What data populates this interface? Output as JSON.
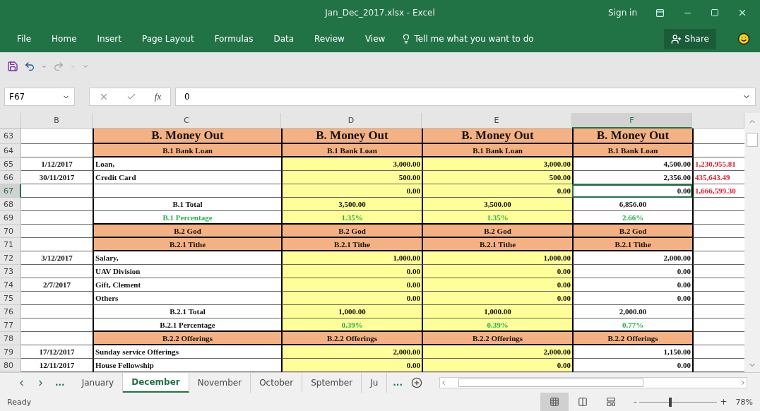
{
  "window": {
    "title": "Jan_Dec_2017.xlsx  -  Excel",
    "sign_in": "Sign in"
  },
  "menu": [
    {
      "label": "File"
    },
    {
      "label": "Home"
    },
    {
      "label": "Insert"
    },
    {
      "label": "Page Layout"
    },
    {
      "label": "Formulas"
    },
    {
      "label": "Data"
    },
    {
      "label": "Review"
    },
    {
      "label": "View"
    }
  ],
  "tell_me": "Tell me what you want to do",
  "share": "Share",
  "formula_bar": {
    "name_box": "F67",
    "fx": "fx",
    "value": "0"
  },
  "columns": [
    {
      "label": "B",
      "selected": false,
      "shaded": false
    },
    {
      "label": "C",
      "selected": false,
      "shaded": false
    },
    {
      "label": "D",
      "selected": false,
      "shaded": true
    },
    {
      "label": "E",
      "selected": false,
      "shaded": true
    },
    {
      "label": "F",
      "selected": true,
      "shaded": false
    }
  ],
  "rows": [
    {
      "n": "63",
      "kind": "title",
      "selected": false,
      "c": "B. Money Out",
      "d": "B. Money Out",
      "e": "B. Money Out",
      "f": "B. Money Out"
    },
    {
      "n": "64",
      "kind": "header",
      "selected": false,
      "c": "B.1 Bank Loan",
      "d": "B.1 Bank Loan",
      "e": "B.1 Bank Loan",
      "f": "B.1 Bank Loan"
    },
    {
      "n": "65",
      "kind": "item",
      "selected": false,
      "b": "1/12/2017",
      "c": "Loan,",
      "d": "3,000.00",
      "e": "3,000.00",
      "f": "4,500.00",
      "g": "1,230,955.81"
    },
    {
      "n": "66",
      "kind": "item",
      "selected": false,
      "b": "30/11/2017",
      "c": "Credit Card",
      "d": "500.00",
      "e": "500.00",
      "f": "2,356.00",
      "g": "435,643.49"
    },
    {
      "n": "67",
      "kind": "item",
      "selected": true,
      "d": "0.00",
      "e": "0.00",
      "f": "0.00",
      "g": "1,666,599.30"
    },
    {
      "n": "68",
      "kind": "total",
      "selected": false,
      "c": "B.1 Total",
      "d": "3,500.00",
      "e": "3,500.00",
      "f": "6,856.00"
    },
    {
      "n": "69",
      "kind": "percent",
      "selected": false,
      "label_green": true,
      "c": "B.1 Percentage",
      "d": "1.35%",
      "e": "1.35%",
      "f": "2.66%"
    },
    {
      "n": "70",
      "kind": "header",
      "selected": false,
      "c": "B.2 God",
      "d": "B.2 God",
      "e": "B.2 God",
      "f": "B.2 God"
    },
    {
      "n": "71",
      "kind": "header",
      "selected": false,
      "c": "B.2.1 Tithe",
      "d": "B.2.1 Tithe",
      "e": "B.2.1 Tithe",
      "f": "B.2.1 Tithe"
    },
    {
      "n": "72",
      "kind": "item",
      "selected": false,
      "b": "3/12/2017",
      "c": "Salary,",
      "d": "1,000.00",
      "e": "1,000.00",
      "f": "2,000.00"
    },
    {
      "n": "73",
      "kind": "item",
      "selected": false,
      "c": "UAV Division",
      "d": "0.00",
      "e": "0.00",
      "f": "0.00"
    },
    {
      "n": "74",
      "kind": "item",
      "selected": false,
      "b": "2/7/2017",
      "c": "Gift, Clement",
      "d": "0.00",
      "e": "0.00",
      "f": "0.00"
    },
    {
      "n": "75",
      "kind": "item",
      "selected": false,
      "c": "Others",
      "d": "0.00",
      "e": "0.00",
      "f": "0.00"
    },
    {
      "n": "76",
      "kind": "total",
      "selected": false,
      "c": "B.2.1 Total",
      "d": "1,000.00",
      "e": "1,000.00",
      "f": "2,000.00"
    },
    {
      "n": "77",
      "kind": "percent",
      "selected": false,
      "label_green": false,
      "c": "B.2.1 Percentage",
      "d": "0.39%",
      "e": "0.39%",
      "f": "0.77%"
    },
    {
      "n": "78",
      "kind": "header",
      "selected": false,
      "c": "B.2.2 Offerings",
      "d": "B.2.2 Offerings",
      "e": "B.2.2 Offerings",
      "f": "B.2.2 Offerings"
    },
    {
      "n": "79",
      "kind": "item",
      "selected": false,
      "b": "17/12/2017",
      "c": "Sunday service Offerings",
      "d": "2,000.00",
      "e": "2,000.00",
      "f": "1,150.00"
    },
    {
      "n": "80",
      "kind": "item",
      "selected": false,
      "b": "12/11/2017",
      "c": "House Fellowship",
      "d": "0.00",
      "e": "0.00",
      "f": "0.00"
    }
  ],
  "sheet_nav_more": "...",
  "sheet_tabs": [
    {
      "label": "January",
      "selected": false
    },
    {
      "label": "December",
      "selected": true
    },
    {
      "label": "November",
      "selected": false
    },
    {
      "label": "October",
      "selected": false
    },
    {
      "label": "Sptember",
      "selected": false
    },
    {
      "label": "Ju",
      "selected": false
    }
  ],
  "sheet_tabs_more": "...",
  "status_bar": {
    "text": "Ready",
    "zoom_out": "-",
    "zoom_in": "+",
    "zoom": "78%",
    "zoom_slider": {
      "level": 0.4
    }
  }
}
